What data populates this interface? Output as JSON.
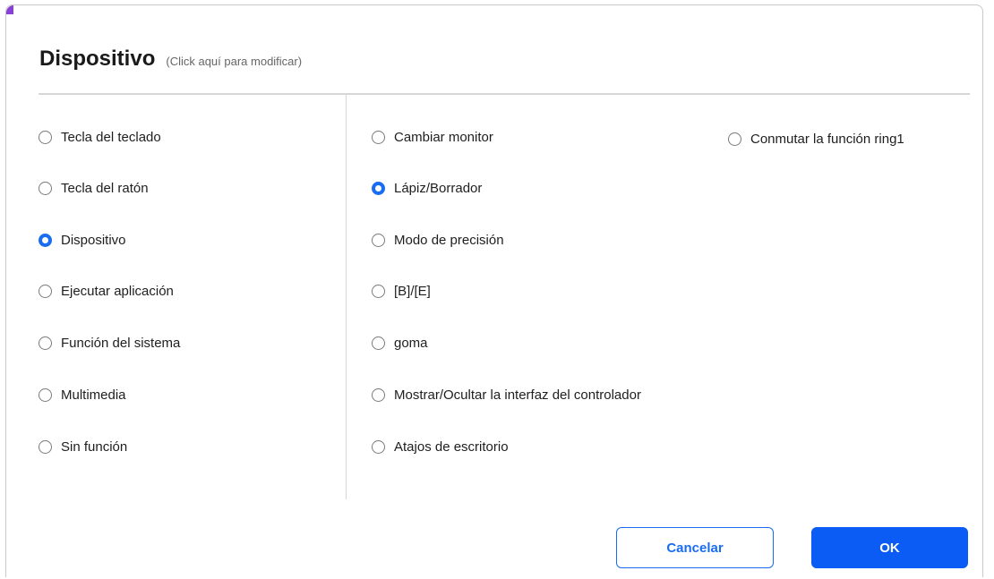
{
  "header": {
    "title": "Dispositivo",
    "hint": "(Click aquí para modificar)"
  },
  "categories": [
    {
      "label": "Tecla del teclado",
      "selected": false
    },
    {
      "label": "Tecla del ratón",
      "selected": false
    },
    {
      "label": "Dispositivo",
      "selected": true
    },
    {
      "label": "Ejecutar aplicación",
      "selected": false
    },
    {
      "label": "Función del sistema",
      "selected": false
    },
    {
      "label": "Multimedia",
      "selected": false
    },
    {
      "label": "Sin función",
      "selected": false
    }
  ],
  "device_options": [
    {
      "label": "Cambiar monitor",
      "selected": false
    },
    {
      "label": "Lápiz/Borrador",
      "selected": true
    },
    {
      "label": "Modo de precisión",
      "selected": false
    },
    {
      "label": "[B]/[E]",
      "selected": false
    },
    {
      "label": "goma",
      "selected": false
    },
    {
      "label": "Mostrar/Ocultar la interfaz del controlador",
      "selected": false
    },
    {
      "label": "Atajos de escritorio",
      "selected": false
    },
    {
      "label": "Conmutar la función ring1",
      "selected": false
    }
  ],
  "buttons": {
    "cancel": "Cancelar",
    "ok": "OK"
  },
  "colors": {
    "accent": "#1a6cf0",
    "primary_button": "#0a5cf5",
    "corner_accent": "#8b3fd9"
  }
}
